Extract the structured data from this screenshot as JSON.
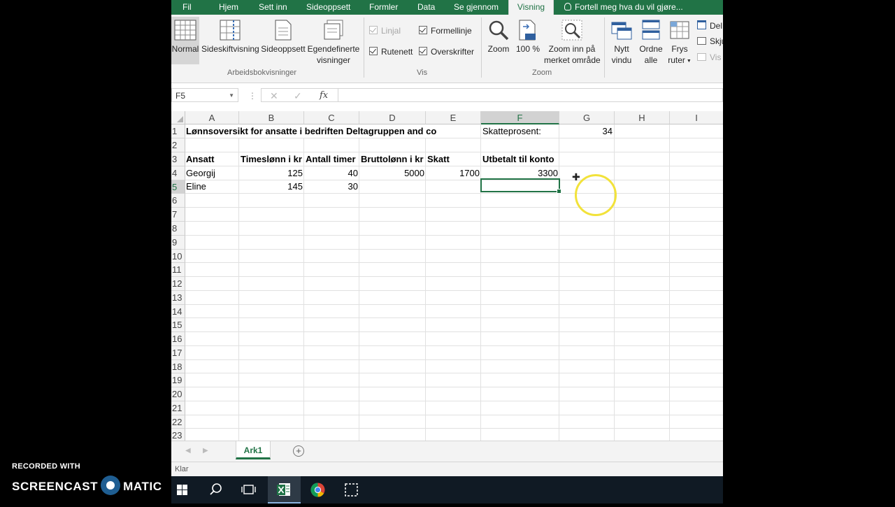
{
  "ribbon_tabs": [
    "Fil",
    "Hjem",
    "Sett inn",
    "Sideoppsett",
    "Formler",
    "Data",
    "Se gjennom",
    "Visning"
  ],
  "active_tab": "Visning",
  "tell_me": "Fortell meg hva du vil gjøre...",
  "groups": {
    "arbeidsbok": {
      "label": "Arbeidsbokvisninger",
      "buttons": [
        "Normal",
        "Sideskiftvisning",
        "Sideoppsett",
        "Egendefinerte",
        "visninger"
      ]
    },
    "vis": {
      "label": "Vis",
      "checks": [
        {
          "label": "Linjal",
          "checked": true,
          "enabled": false
        },
        {
          "label": "Formellinje",
          "checked": true,
          "enabled": true
        },
        {
          "label": "Rutenett",
          "checked": true,
          "enabled": true
        },
        {
          "label": "Overskrifter",
          "checked": true,
          "enabled": true
        }
      ]
    },
    "zoom": {
      "label": "Zoom",
      "buttons": [
        "Zoom",
        "100 %",
        "Zoom inn på",
        "merket område"
      ]
    },
    "vindu": {
      "buttons": [
        "Nytt",
        "vindu",
        "Ordne",
        "alle",
        "Frys",
        "ruter"
      ],
      "small": [
        "Del",
        "Skju",
        "Vis"
      ]
    }
  },
  "formula_bar": {
    "name_box": "F5",
    "fx": "fx",
    "content": ""
  },
  "columns": [
    "A",
    "B",
    "C",
    "D",
    "E",
    "F",
    "G",
    "H",
    "I"
  ],
  "selected_column": "F",
  "rows": [
    "1",
    "2",
    "3",
    "4",
    "5",
    "6",
    "7",
    "8",
    "9",
    "10",
    "11",
    "12",
    "13",
    "14",
    "15",
    "16",
    "17",
    "18",
    "19",
    "20",
    "21",
    "22",
    "23"
  ],
  "selected_row": "5",
  "cells": {
    "A1": "Lønnsoversikt for ansatte i bedriften Deltagruppen and co",
    "F1": "Skatteprosent:",
    "G1": "34",
    "A3": "Ansatt",
    "B3": "Timeslønn i kr",
    "C3": "Antall timer",
    "D3": "Bruttolønn i kr",
    "E3": "Skatt",
    "F3": "Utbetalt til konto",
    "A4": "Georgij",
    "B4": "125",
    "C4": "40",
    "D4": "5000",
    "E4": "1700",
    "F4": "3300",
    "A5": "Eline",
    "B5": "145",
    "C5": "30"
  },
  "sheet_tabs": [
    "Ark1"
  ],
  "status": "Klar",
  "watermark": {
    "line1": "RECORDED WITH",
    "left": "SCREENCAST",
    "right": "MATIC"
  },
  "colors": {
    "accent": "#217346",
    "highlight": "#f2e23a"
  }
}
